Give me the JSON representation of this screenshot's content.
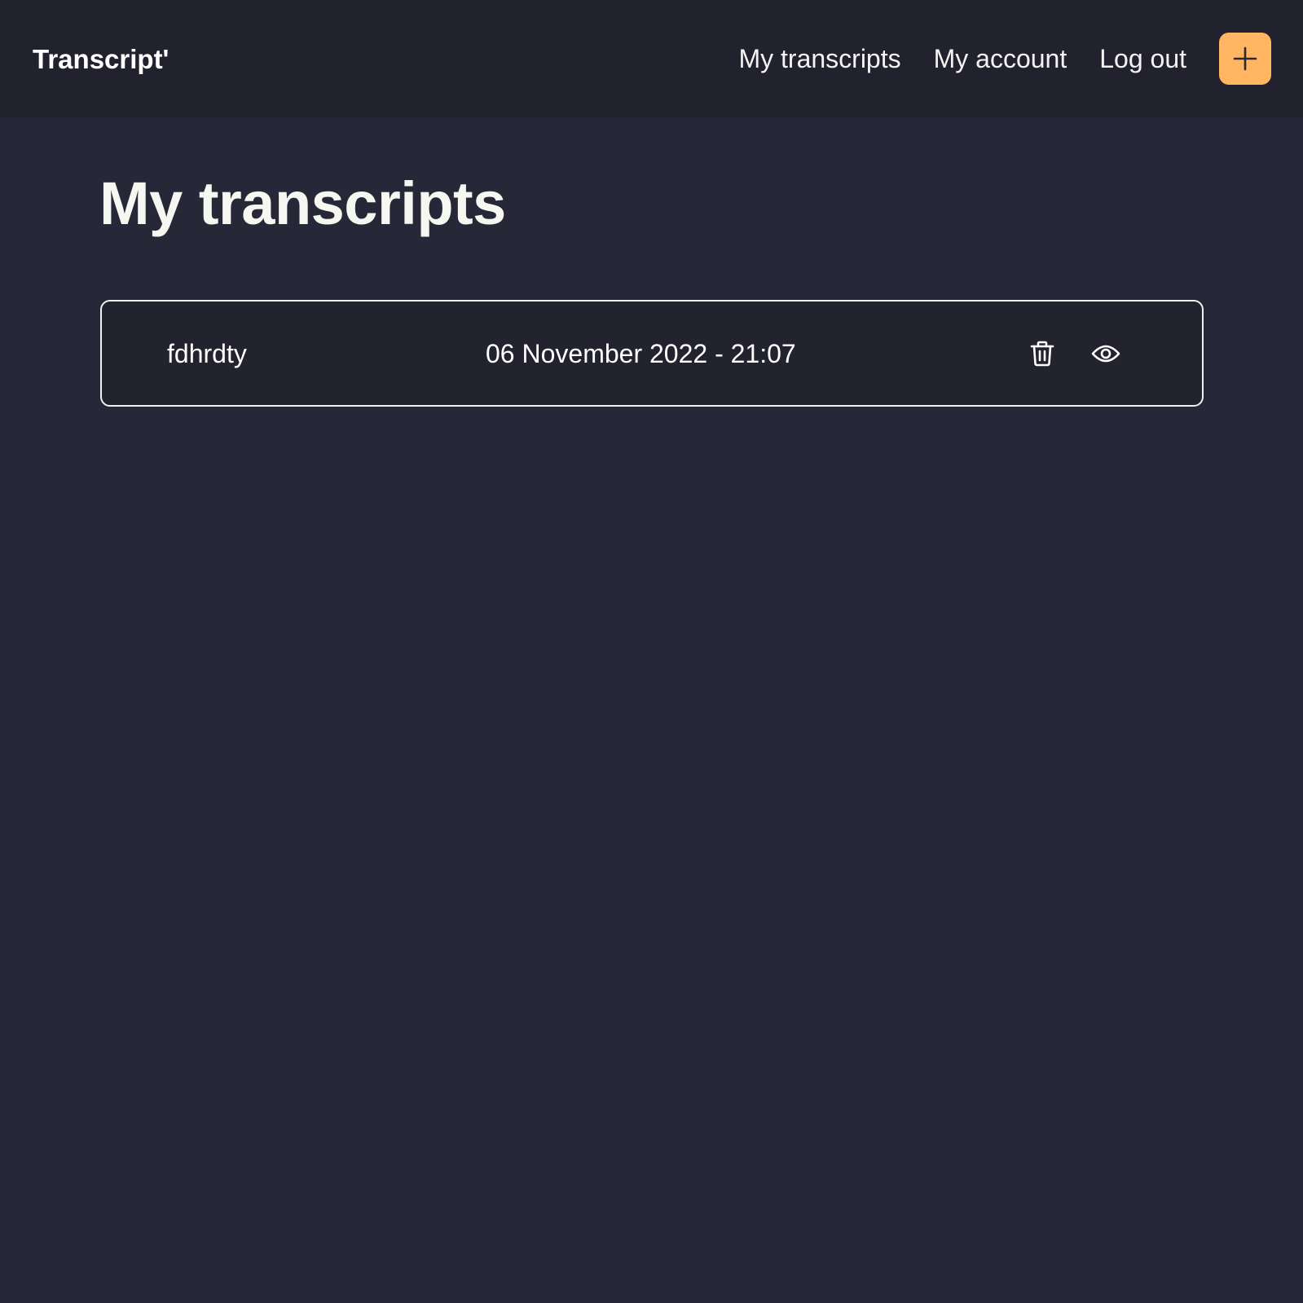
{
  "navbar": {
    "brand": "Transcript'",
    "links": [
      {
        "label": "My transcripts"
      },
      {
        "label": "My account"
      },
      {
        "label": "Log out"
      }
    ],
    "add_button_icon": "plus-icon",
    "add_button_color": "#ffb561"
  },
  "page": {
    "title": "My transcripts"
  },
  "transcripts": [
    {
      "name": "fdhrdty",
      "date": "06 November 2022 - 21:07",
      "delete_icon": "trash-icon",
      "view_icon": "eye-icon"
    }
  ],
  "colors": {
    "background": "#262837",
    "navbar": "#21222e",
    "accent": "#ffb561"
  }
}
